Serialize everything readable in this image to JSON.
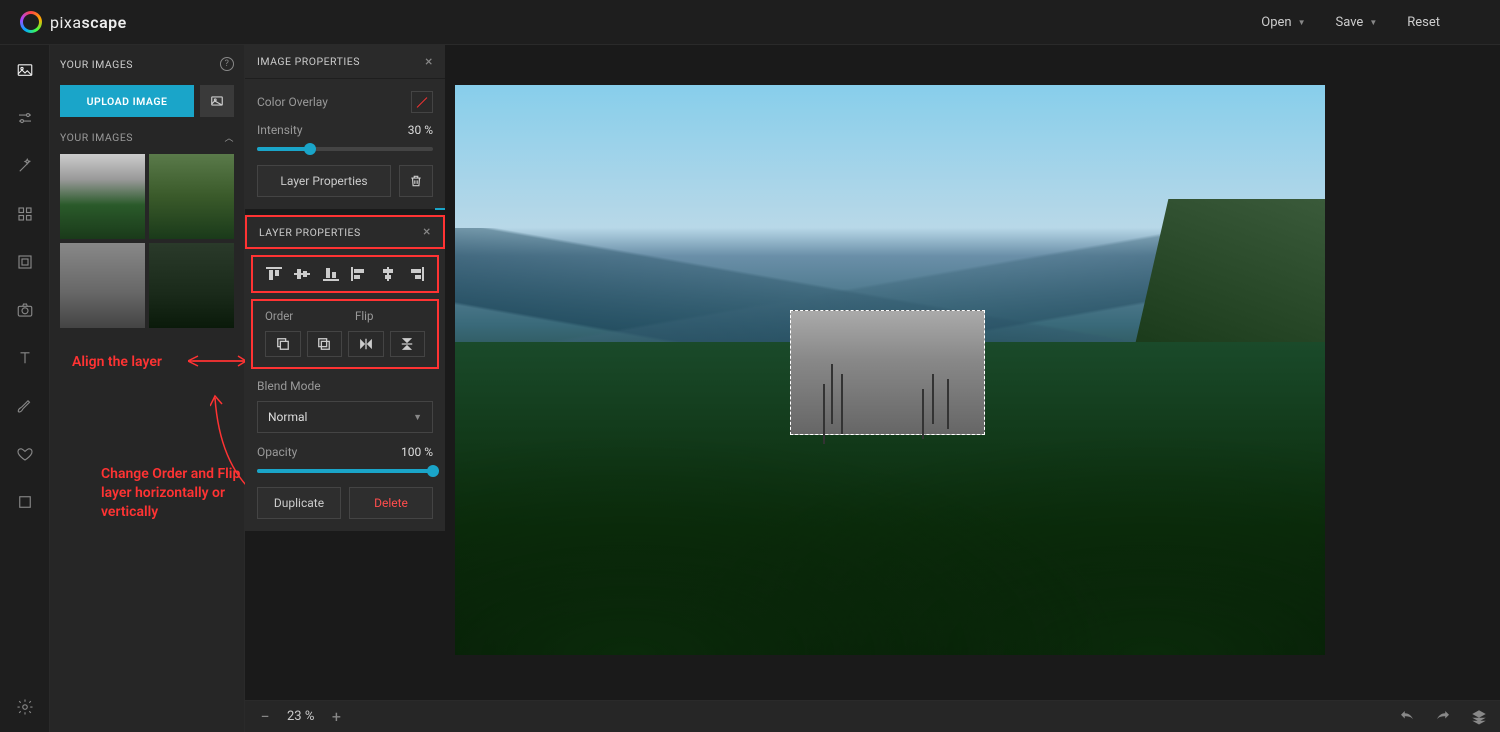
{
  "app": {
    "name_light": "pixa",
    "name_bold": "scape"
  },
  "header": {
    "open": "Open",
    "save": "Save",
    "reset": "Reset"
  },
  "images_panel": {
    "title": "YOUR IMAGES",
    "upload": "UPLOAD IMAGE",
    "section": "YOUR IMAGES"
  },
  "image_props": {
    "title": "IMAGE PROPERTIES",
    "color_overlay": "Color Overlay",
    "intensity_label": "Intensity",
    "intensity_value": "30 %",
    "intensity_pct": 30,
    "layer_props_btn": "Layer Properties"
  },
  "layer_props": {
    "title": "LAYER PROPERTIES",
    "order_label": "Order",
    "flip_label": "Flip",
    "blend_label": "Blend Mode",
    "blend_value": "Normal",
    "opacity_label": "Opacity",
    "opacity_value": "100 %",
    "opacity_pct": 100,
    "duplicate": "Duplicate",
    "delete": "Delete"
  },
  "annotations": {
    "align": "Align the layer",
    "order_flip": "Change Order and Flip layer horizontally or vertically"
  },
  "zoom": {
    "value": "23 %"
  }
}
